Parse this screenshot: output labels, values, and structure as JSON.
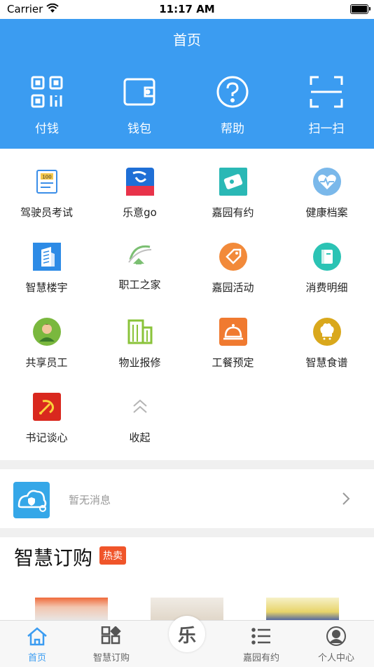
{
  "status_bar": {
    "carrier": "Carrier",
    "time": "11:17 AM"
  },
  "header": {
    "title": "首页"
  },
  "quick_actions": [
    {
      "label": "付钱",
      "icon": "qr-code-icon"
    },
    {
      "label": "钱包",
      "icon": "wallet-icon"
    },
    {
      "label": "帮助",
      "icon": "help-icon"
    },
    {
      "label": "扫一扫",
      "icon": "scan-icon"
    }
  ],
  "services": [
    {
      "label": "驾驶员考试",
      "icon": "exam-icon"
    },
    {
      "label": "乐意go",
      "icon": "leyigo-icon",
      "logo_text": "乐意go"
    },
    {
      "label": "嘉园有约",
      "icon": "ticket-icon"
    },
    {
      "label": "健康档案",
      "icon": "heart-icon"
    },
    {
      "label": "智慧楼宇",
      "icon": "building-icon"
    },
    {
      "label": "职工之家",
      "icon": "home-icon"
    },
    {
      "label": "嘉园活动",
      "icon": "tag-icon"
    },
    {
      "label": "消费明细",
      "icon": "book-icon"
    },
    {
      "label": "共享员工",
      "icon": "person-icon"
    },
    {
      "label": "物业报修",
      "icon": "office-icon"
    },
    {
      "label": "工餐预定",
      "icon": "dish-icon"
    },
    {
      "label": "智慧食谱",
      "icon": "chef-icon"
    },
    {
      "label": "书记谈心",
      "icon": "party-icon"
    },
    {
      "label": "收起",
      "icon": "collapse-icon"
    }
  ],
  "message": {
    "text": "暂无消息"
  },
  "shop": {
    "title": "智慧订购",
    "tag": "热卖"
  },
  "tabbar": [
    {
      "label": "首页",
      "icon": "home-tab-icon",
      "active": true
    },
    {
      "label": "智慧订购",
      "icon": "apps-tab-icon",
      "active": false
    },
    {
      "label": "乐",
      "icon": "center-logo",
      "active": false
    },
    {
      "label": "嘉园有约",
      "icon": "list-tab-icon",
      "active": false
    },
    {
      "label": "个人中心",
      "icon": "profile-tab-icon",
      "active": false
    }
  ],
  "colors": {
    "primary": "#3b9cf1",
    "hot_tag": "#f0552a"
  }
}
